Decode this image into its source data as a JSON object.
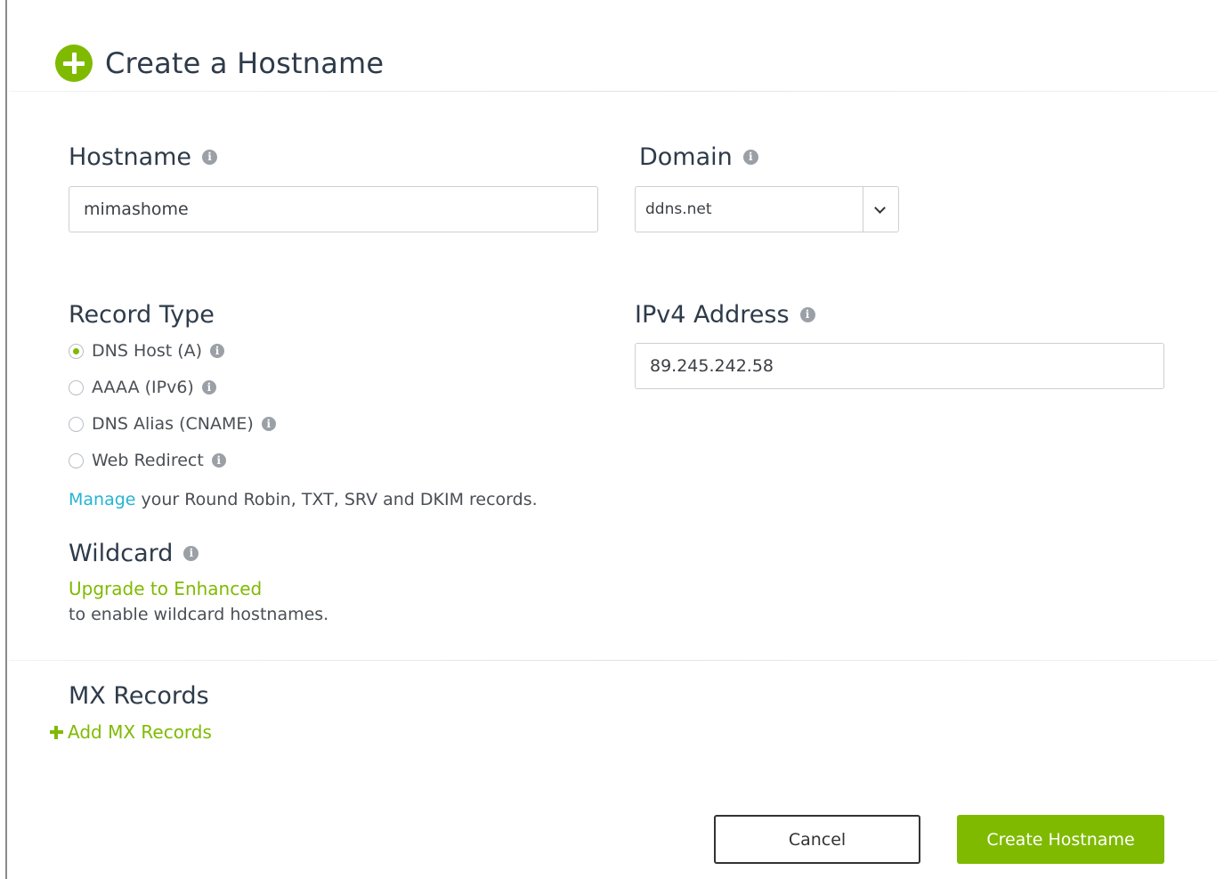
{
  "header": {
    "title": "Create a Hostname",
    "icon": "plus-circle-icon"
  },
  "hostname": {
    "label": "Hostname",
    "value": "mimashome"
  },
  "domain": {
    "label": "Domain",
    "selected": "ddns.net"
  },
  "record_type": {
    "label": "Record Type",
    "options": [
      {
        "label": "DNS Host (A)",
        "checked": true
      },
      {
        "label": "AAAA (IPv6)",
        "checked": false
      },
      {
        "label": "DNS Alias (CNAME)",
        "checked": false
      },
      {
        "label": "Web Redirect",
        "checked": false
      }
    ],
    "manage_link": "Manage",
    "manage_text": " your Round Robin, TXT, SRV and DKIM records."
  },
  "ipv4": {
    "label": "IPv4 Address",
    "value": "89.245.242.58"
  },
  "wildcard": {
    "label": "Wildcard",
    "upgrade_link": "Upgrade to Enhanced",
    "note": "to enable wildcard hostnames."
  },
  "mx": {
    "label": "MX Records",
    "add_link": "Add MX Records"
  },
  "actions": {
    "cancel": "Cancel",
    "create": "Create Hostname"
  },
  "colors": {
    "accent": "#7fba00",
    "link": "#23b5d3",
    "title": "#2e3b4a"
  }
}
